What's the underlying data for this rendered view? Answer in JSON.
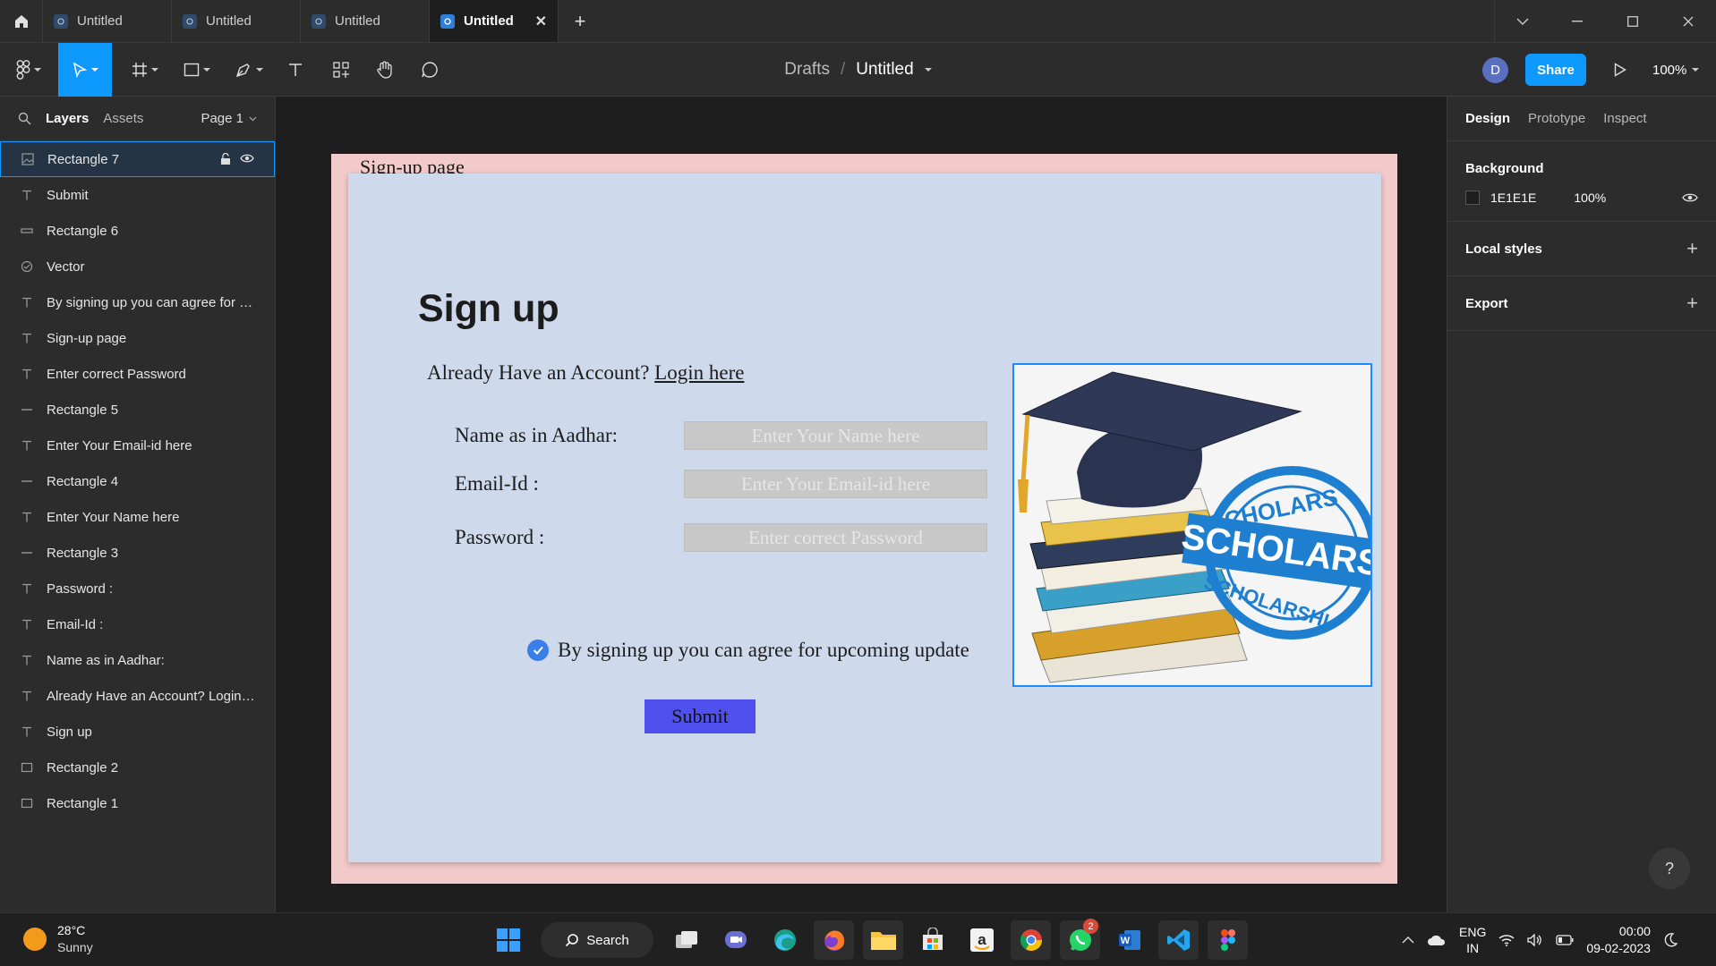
{
  "tabs": [
    {
      "title": "Untitled",
      "active": false
    },
    {
      "title": "Untitled",
      "active": false
    },
    {
      "title": "Untitled",
      "active": false
    },
    {
      "title": "Untitled",
      "active": true
    }
  ],
  "toolbar": {
    "breadcrumb_drafts": "Drafts",
    "breadcrumb_sep": "/",
    "file_name": "Untitled",
    "avatar_initial": "D",
    "share_label": "Share",
    "zoom": "100%"
  },
  "left_panel": {
    "tab_layers": "Layers",
    "tab_assets": "Assets",
    "page": "Page 1",
    "layers": [
      {
        "name": "Rectangle 7",
        "icon": "image",
        "selected": true
      },
      {
        "name": "Submit",
        "icon": "text"
      },
      {
        "name": "Rectangle 6",
        "icon": "rect-thin"
      },
      {
        "name": "Vector",
        "icon": "vector"
      },
      {
        "name": "By signing up you can agree for upc...",
        "icon": "text"
      },
      {
        "name": "Sign-up page",
        "icon": "text"
      },
      {
        "name": "Enter correct Password",
        "icon": "text"
      },
      {
        "name": "Rectangle 5",
        "icon": "line"
      },
      {
        "name": "Enter Your Email-id here",
        "icon": "text"
      },
      {
        "name": "Rectangle 4",
        "icon": "line"
      },
      {
        "name": "Enter Your Name here",
        "icon": "text"
      },
      {
        "name": "Rectangle 3",
        "icon": "line"
      },
      {
        "name": "Password :",
        "icon": "text"
      },
      {
        "name": "Email-Id :",
        "icon": "text"
      },
      {
        "name": "Name as in Aadhar:",
        "icon": "text"
      },
      {
        "name": "Already Have an Account? Login here",
        "icon": "text"
      },
      {
        "name": "Sign up",
        "icon": "text"
      },
      {
        "name": "Rectangle 2",
        "icon": "rect"
      },
      {
        "name": "Rectangle 1",
        "icon": "rect"
      }
    ]
  },
  "right_panel": {
    "tab_design": "Design",
    "tab_prototype": "Prototype",
    "tab_inspect": "Inspect",
    "background_title": "Background",
    "background_hex": "1E1E1E",
    "background_opacity": "100%",
    "local_styles": "Local styles",
    "export": "Export",
    "help": "?"
  },
  "canvas": {
    "frame_label": "Sign-up page",
    "title": "Sign up",
    "already_text": "Already Have an Account?",
    "login_link": "Login here",
    "name_label": "Name as in Aadhar:",
    "name_placeholder": "Enter Your Name here",
    "email_label": "Email-Id :",
    "email_placeholder": "Enter Your Email-id here",
    "password_label": "Password :",
    "password_placeholder": "Enter correct Password",
    "agree_text": "By signing up you can agree for upcoming update",
    "submit_label": "Submit",
    "stamp_text": "SCHOLARS",
    "stamp_ring_top": "SCHOLARS",
    "stamp_ring_bottom": "SCHOLARSHI"
  },
  "taskbar": {
    "temperature": "28°C",
    "condition": "Sunny",
    "search_label": "Search",
    "whatsapp_badge": "2",
    "lang_line1": "ENG",
    "lang_line2": "IN",
    "time": "00:00",
    "date": "09-02-2023"
  },
  "colors": {
    "accent": "#0d99ff",
    "frame_outer": "#f2caca",
    "frame_inner": "#cfd9ec",
    "submit_bg": "#5050ee"
  }
}
